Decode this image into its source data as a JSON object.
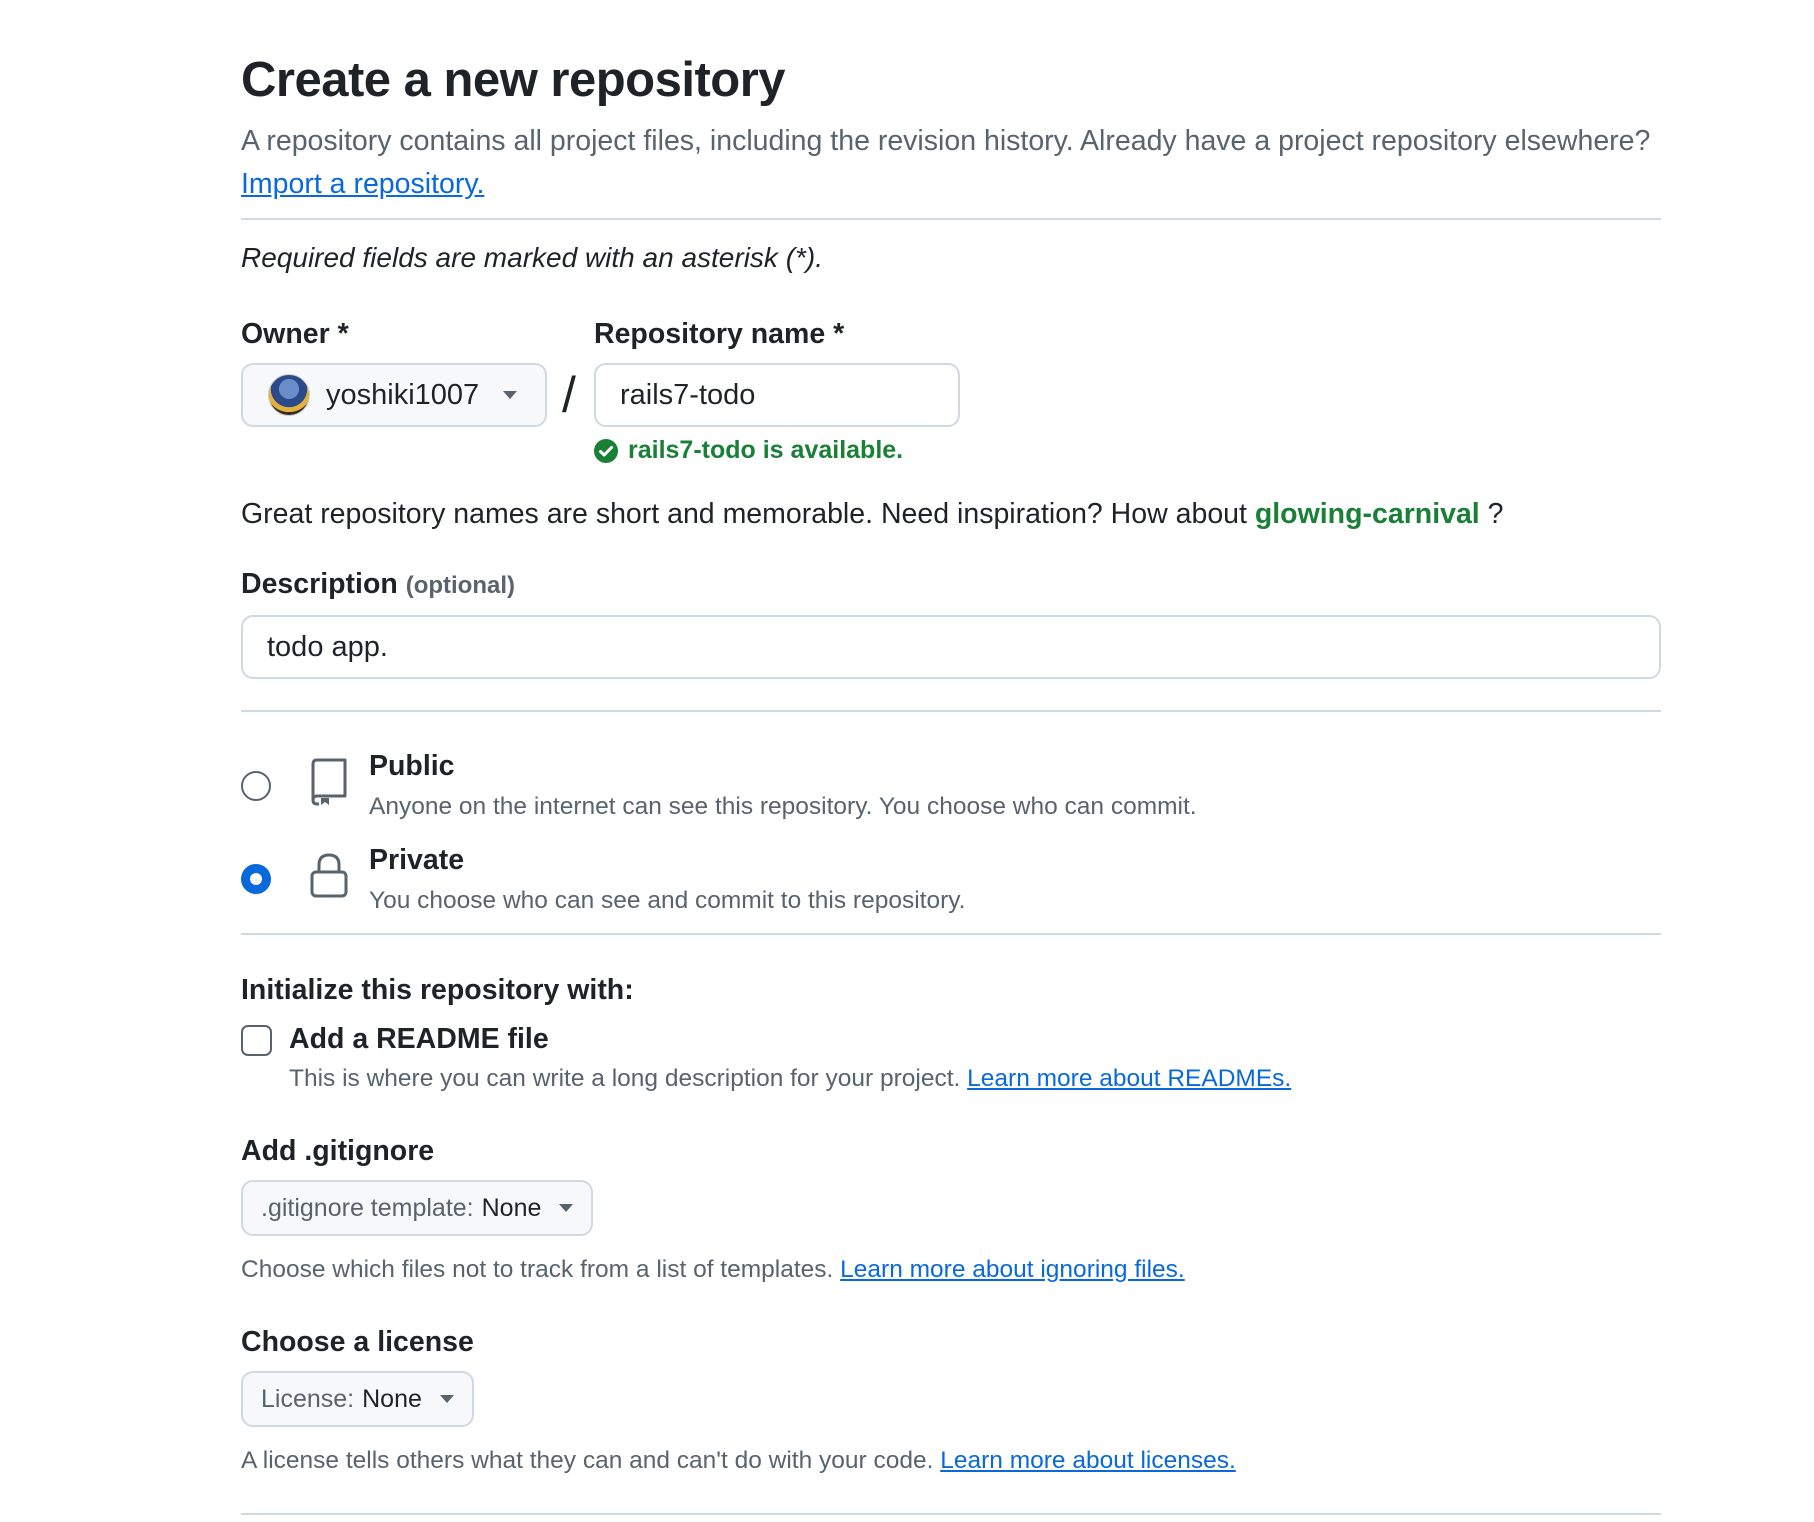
{
  "header": {
    "title": "Create a new repository",
    "lead": "A repository contains all project files, including the revision history. Already have a project repository elsewhere?",
    "import_link": "Import a repository."
  },
  "required_note": "Required fields are marked with an asterisk (*).",
  "owner": {
    "label": "Owner *",
    "value": "yoshiki1007",
    "icon": "avatar"
  },
  "separator": "/",
  "repo_name": {
    "label": "Repository name *",
    "value": "rails7-todo",
    "availability": "rails7-todo is available.",
    "availability_icon": "check-circle-icon"
  },
  "suggestion": {
    "text": "Great repository names are short and memorable. Need inspiration? How about",
    "name": "glowing-carnival",
    "end": "?"
  },
  "description": {
    "label": "Description",
    "optional": "(optional)",
    "value": "todo app."
  },
  "visibility": {
    "options": [
      {
        "title": "Public",
        "subtitle": "Anyone on the internet can see this repository. You choose who can commit.",
        "icon": "repo-icon",
        "selected": false
      },
      {
        "title": "Private",
        "subtitle": "You choose who can see and commit to this repository.",
        "icon": "lock-icon",
        "selected": true
      }
    ]
  },
  "initialize": {
    "heading": "Initialize this repository with:",
    "readme_label": "Add a README file",
    "readme_checked": false,
    "readme_help": "This is where you can write a long description for your project.",
    "readme_link": "Learn more about READMEs."
  },
  "gitignore": {
    "heading": "Add .gitignore",
    "select_prefix": ".gitignore template:",
    "select_value": "None",
    "help": "Choose which files not to track from a list of templates.",
    "link": "Learn more about ignoring files."
  },
  "license": {
    "heading": "Choose a license",
    "select_prefix": "License:",
    "select_value": "None",
    "help": "A license tells others what they can and can't do with your code.",
    "link": "Learn more about licenses."
  },
  "colors": {
    "link": "#0969da",
    "success": "#1a7f37",
    "muted": "#59636e",
    "border": "#d1d9e0"
  }
}
